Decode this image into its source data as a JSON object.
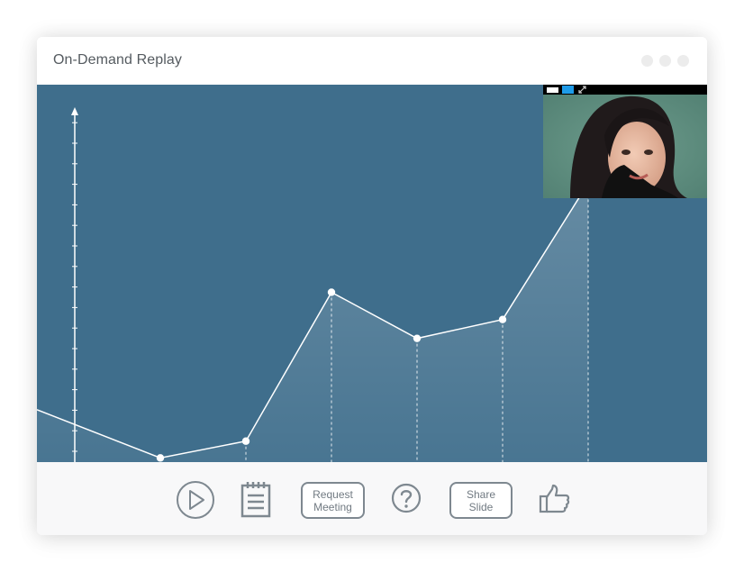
{
  "window": {
    "title": "On-Demand Replay",
    "controls": [
      "dot-1",
      "dot-2",
      "dot-3"
    ]
  },
  "presentation": {
    "content": "line-chart-slide",
    "grid": false,
    "colors": {
      "background": "#3f6e8c",
      "line": "#ffffff",
      "fill": "#ffffff"
    }
  },
  "chart_data": {
    "type": "area",
    "title": "",
    "xlabel": "",
    "ylabel": "",
    "ylim": [
      0,
      18
    ],
    "x": [
      0,
      1,
      2,
      3,
      4,
      5,
      6
    ],
    "series": [
      {
        "values": [
          2.5,
          0.2,
          1.0,
          8.1,
          5.9,
          6.8,
          13.3
        ]
      }
    ],
    "markers_at": [
      1,
      2,
      3,
      4,
      5
    ],
    "dashed_drop_lines_at": [
      2,
      3,
      4,
      5,
      6
    ]
  },
  "video_overlay": {
    "controls": [
      "white-tab",
      "blue-tab",
      "expand-icon"
    ],
    "colors": {
      "bar": "#000000",
      "accent": "#1e9be8"
    }
  },
  "toolbar": {
    "play_icon": "play-icon",
    "handout_icon": "notepad-icon",
    "request_meeting_label": "Request\nMeeting",
    "help_icon": "question-icon",
    "share_slide_label": "Share\nSlide",
    "like_icon": "thumbs-up-icon"
  }
}
